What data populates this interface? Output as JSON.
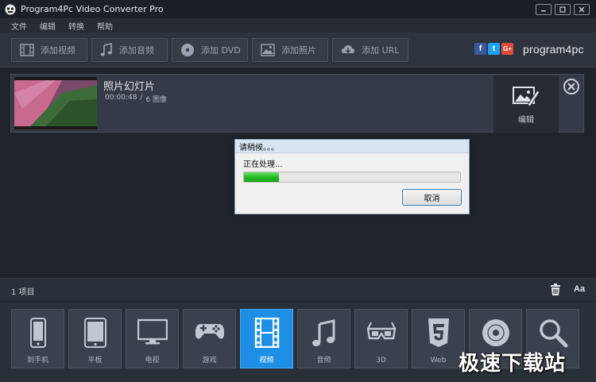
{
  "window": {
    "title": "Program4Pc Video Converter Pro"
  },
  "menu": [
    "文件",
    "编辑",
    "转换",
    "帮助"
  ],
  "toolbar": {
    "add_video": "添加视频",
    "add_audio": "添加音频",
    "add_dvd": "添加 DVD",
    "add_photo": "添加照片",
    "add_url": "添加 URL"
  },
  "social": {
    "facebook": "f",
    "twitter": "t",
    "google": "G+"
  },
  "brand": {
    "logo": "program4pc"
  },
  "file": {
    "title": "照片幻灯片",
    "duration": "00:00:48",
    "separator": "/",
    "images": "6 图像",
    "edit_label": "编辑"
  },
  "dialog": {
    "title": "请稍候。。。",
    "message": "正在处理...",
    "progress": 0.16,
    "cancel": "取消"
  },
  "status": {
    "count": "1 项目",
    "font_button": "Aa"
  },
  "devices": [
    {
      "label": "到手机",
      "icon": "phone-icon",
      "active": false
    },
    {
      "label": "平板",
      "icon": "tablet-icon",
      "active": false
    },
    {
      "label": "电视",
      "icon": "tv-icon",
      "active": false
    },
    {
      "label": "游戏",
      "icon": "gamepad-icon",
      "active": false
    },
    {
      "label": "视频",
      "icon": "film-icon",
      "active": true
    },
    {
      "label": "音频",
      "icon": "music-icon",
      "active": false
    },
    {
      "label": "3D",
      "icon": "3d-glasses-icon",
      "active": false
    },
    {
      "label": "Web",
      "icon": "html5-icon",
      "active": false
    },
    {
      "label": "",
      "icon": "disc-icon",
      "active": false
    },
    {
      "label": "",
      "icon": "search-icon",
      "active": false
    }
  ],
  "watermark": "极速下载站",
  "colors": {
    "accent": "#1f8fe6",
    "progress": "#22b822",
    "background": "#1f242c"
  }
}
